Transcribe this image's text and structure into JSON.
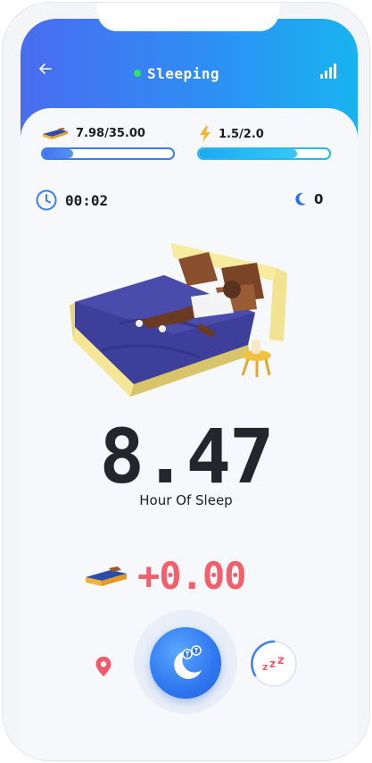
{
  "header": {
    "title": "Sleeping",
    "back_icon": "back-arrow-icon",
    "signal_icon": "signal-bars-icon",
    "status_color": "#2fe36a"
  },
  "stats": {
    "energy_value": "7.98/35.00",
    "energy_fill": 0.23,
    "power_value": "1.5/2.0",
    "power_fill": 0.75
  },
  "timer": {
    "time": "00:02"
  },
  "moon": {
    "count": "0"
  },
  "sleep": {
    "hours": "8.47",
    "label": "Hour Of Sleep"
  },
  "earnings": {
    "value": "+0.00"
  },
  "colors": {
    "accent": "#3b7df5",
    "earn": "#f0616b",
    "header_start": "#4a6cf0",
    "header_end": "#18b4f0"
  }
}
